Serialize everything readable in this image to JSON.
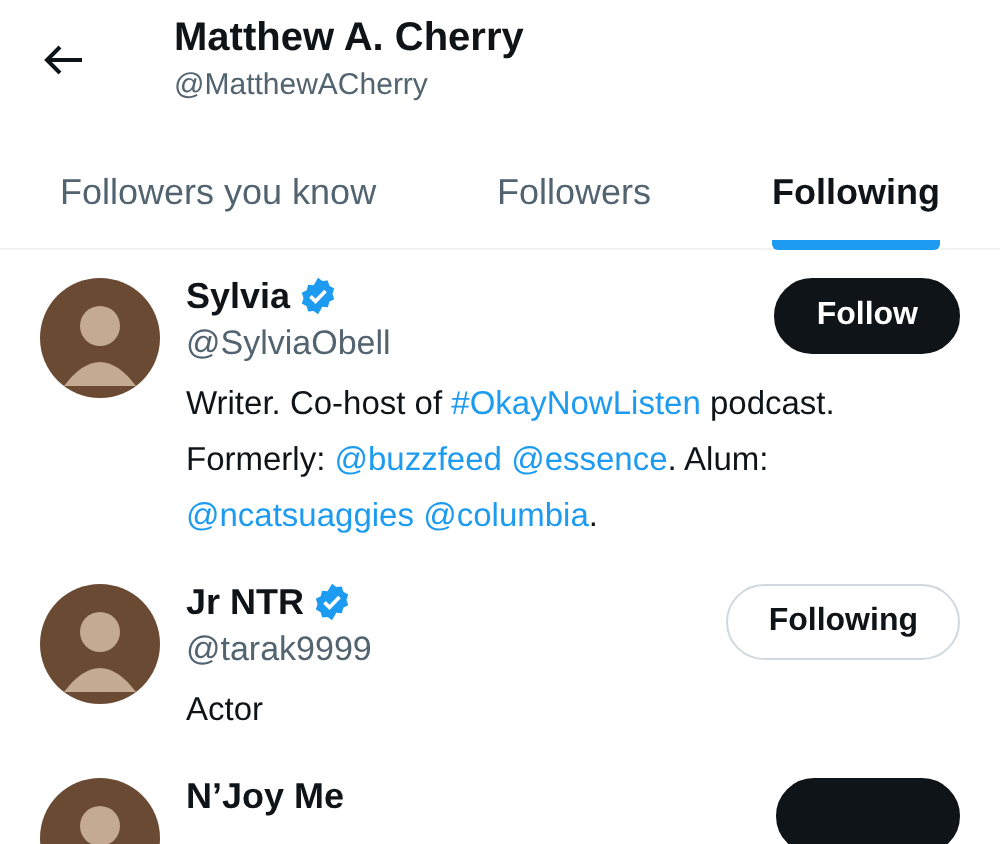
{
  "header": {
    "title": "Matthew A. Cherry",
    "handle": "@MatthewACherry"
  },
  "tabs": [
    {
      "label": "Followers you know",
      "selected": false
    },
    {
      "label": "Followers",
      "selected": false
    },
    {
      "label": "Following",
      "selected": true
    }
  ],
  "users": [
    {
      "name": "Sylvia",
      "verified": true,
      "handle": "@SylviaObell",
      "button": "Follow",
      "following": false,
      "bio": [
        {
          "kind": "text",
          "text": "Writer. Co-host of "
        },
        {
          "kind": "link",
          "text": "#OkayNowListen"
        },
        {
          "kind": "text",
          "text": " podcast. Formerly: "
        },
        {
          "kind": "link",
          "text": "@buzzfeed"
        },
        {
          "kind": "link",
          "text": "@essence"
        },
        {
          "kind": "text",
          "text": ". Alum: "
        },
        {
          "kind": "link",
          "text": "@ncatsuaggies"
        },
        {
          "kind": "link",
          "text": "@columbia"
        },
        {
          "kind": "text",
          "text": "."
        }
      ]
    },
    {
      "name": "Jr NTR",
      "verified": true,
      "handle": "@tarak9999",
      "button": "Following",
      "following": true,
      "bio": [
        {
          "kind": "text",
          "text": "Actor"
        }
      ]
    },
    {
      "name": "N’Joy Me",
      "following": false
    }
  ]
}
